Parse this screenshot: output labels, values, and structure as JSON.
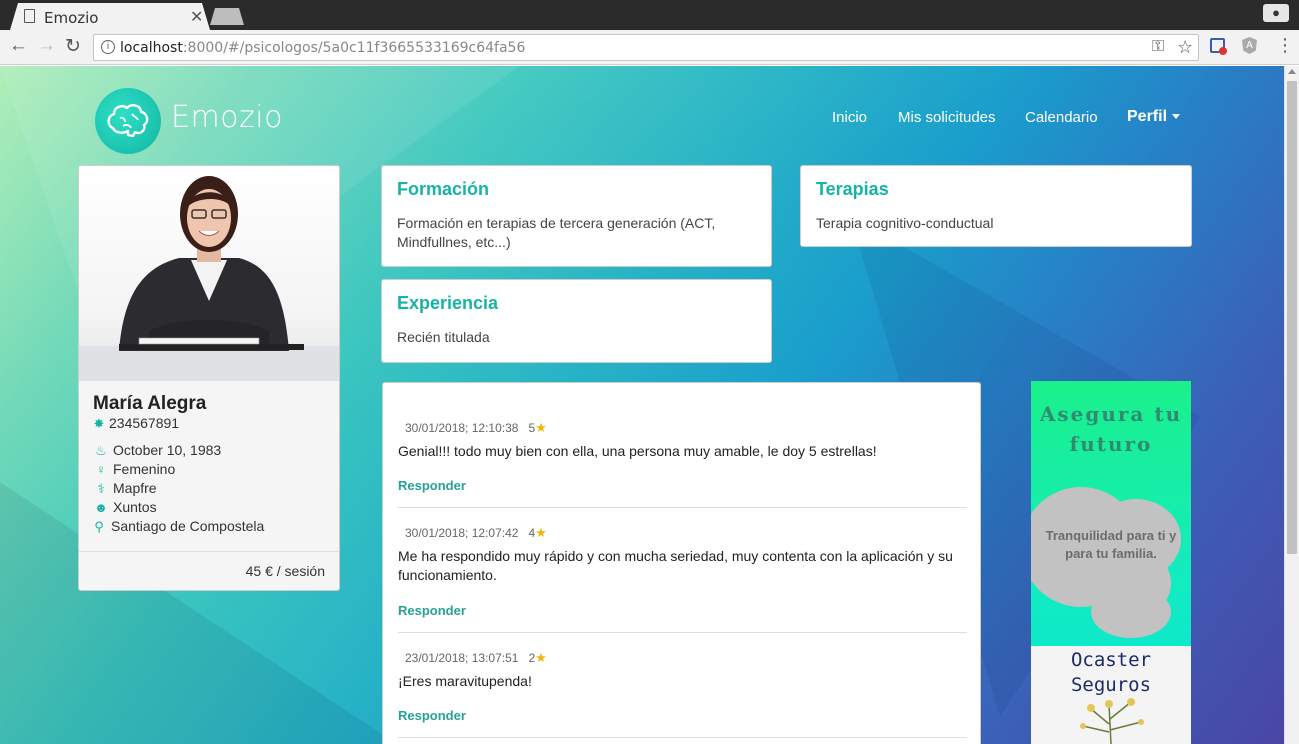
{
  "browser": {
    "tab_title": "Emozio",
    "url_host": "localhost",
    "url_path": ":8000/#/psicologos/5a0c11f3665533169c64fa56"
  },
  "nav": {
    "brand": "Emozio",
    "items": [
      "Inicio",
      "Mis solicitudes",
      "Calendario"
    ],
    "perfil": "Perfil"
  },
  "profile": {
    "name": "María Alegra",
    "license": "234567891",
    "birthdate": "October 10, 1983",
    "gender": "Femenino",
    "insurance": "Mapfre",
    "group": "Xuntos",
    "city": "Santiago de Compostela",
    "price": "45 € / sesión"
  },
  "cards": {
    "formacion": {
      "title": "Formación",
      "body": "Formación en terapias de tercera generación (ACT, Mindfullnes, etc...)"
    },
    "terapias": {
      "title": "Terapias",
      "body": "Terapia cognitivo-conductual"
    },
    "experiencia": {
      "title": "Experiencia",
      "body": "Recién titulada"
    }
  },
  "reviews": [
    {
      "date": "30/01/2018; 12:10:38",
      "stars": "5",
      "text": "Genial!!! todo muy bien con ella, una persona muy amable, le doy 5 estrellas!",
      "reply": "Responder"
    },
    {
      "date": "30/01/2018; 12:07:42",
      "stars": "4",
      "text": "Me ha respondido muy rápido y con mucha seriedad, muy contenta con la aplicación y su funcionamiento.",
      "reply": "Responder"
    },
    {
      "date": "23/01/2018; 13:07:51",
      "stars": "2",
      "text": "¡Eres maravitupenda!",
      "reply": "Responder"
    }
  ],
  "ad": {
    "headline": "Asegura tu futuro",
    "tagline": "Tranquilidad para ti y para tu familia.",
    "brand": "Ocaster Seguros"
  },
  "colors": {
    "accent": "#17b3a4",
    "star": "#f2b600"
  },
  "icons": [
    "page-icon",
    "close-icon",
    "back-icon",
    "forward-icon",
    "reload-icon",
    "info-icon",
    "key-icon",
    "star-icon",
    "menu-icon",
    "brain-logo-icon",
    "badge-icon",
    "cake-icon",
    "user-icon",
    "stethoscope-icon",
    "users-icon",
    "map-marker-icon"
  ]
}
